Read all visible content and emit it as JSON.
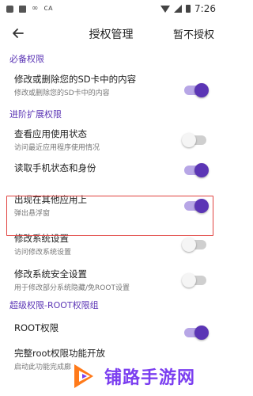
{
  "status_bar": {
    "time": "7:26"
  },
  "app_bar": {
    "title": "授权管理",
    "action": "暂不授权"
  },
  "sections": [
    {
      "header": "必备权限"
    },
    {
      "header": "进阶扩展权限"
    },
    {
      "header": "超级权限-ROOT权限组"
    }
  ],
  "rows": {
    "sd": {
      "title": "修改或删除您的SD卡中的内容",
      "subtitle": "修改或删除您的SD卡中的内容",
      "enabled": true
    },
    "usage": {
      "title": "查看应用使用状态",
      "subtitle": "访问最近应用程序使用情况",
      "enabled": false
    },
    "phone": {
      "title": "读取手机状态和身份",
      "subtitle": "",
      "enabled": true
    },
    "overlay": {
      "title": "出现在其他应用上",
      "subtitle": "弹出悬浮窗",
      "enabled": true
    },
    "sys": {
      "title": "修改系统设置",
      "subtitle": "访问修改系统设置",
      "enabled": false
    },
    "secure": {
      "title": "修改系统安全设置",
      "subtitle": "用于修改部分系统隐藏/免ROOT设置",
      "enabled": false
    },
    "root": {
      "title": "ROOT权限",
      "subtitle": "",
      "enabled": true
    },
    "fullroot": {
      "title": "完整root权限功能开放",
      "subtitle": "启动此功能完成廊",
      "enabled": false
    }
  },
  "watermark": {
    "text": "铺路手游网"
  },
  "colors": {
    "accent": "#5b35b5",
    "highlight": "#e0423f"
  },
  "icons": {
    "back": "arrow-left-icon"
  }
}
